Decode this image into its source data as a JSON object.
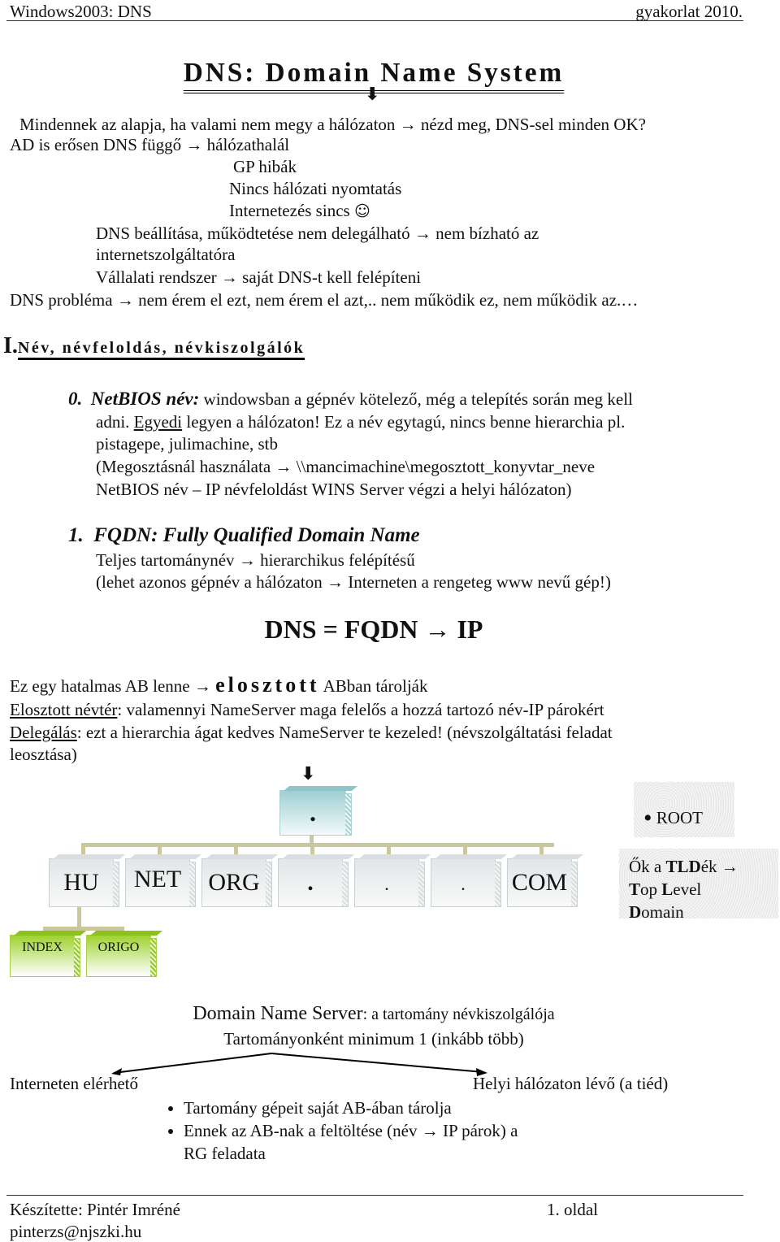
{
  "header": {
    "left": "Windows2003: DNS",
    "right": "gyakorlat 2010."
  },
  "title": "DNS: Domain Name System",
  "icons": {
    "arrow_right": "→",
    "arrow_down": "⬇",
    "smiley": "☺"
  },
  "intro": {
    "line1": "Mindennek az alapja, ha valami nem megy a hálózaton",
    "line1b": "nézd meg, DNS-sel minden OK?",
    "line2": "AD is erősen DNS függő",
    "line2b": "hálózathalál",
    "line3": "GP hibák",
    "line4": "Nincs hálózati nyomtatás",
    "line5": "Internetezés sincs",
    "line6": "DNS beállítása, működtetése nem delegálható",
    "line6b": "nem bízható az",
    "line7": "internetszolgáltatóra",
    "line8": "Vállalati rendszer",
    "line8b": "saját DNS-t kell felépíteni",
    "line9": "DNS probléma",
    "line9b": "nem érem el ezt, nem érem el azt,.. nem működik ez, nem működik az.…"
  },
  "section1": {
    "number": "I.",
    "title": "Név, névfeloldás, névkiszolgálók"
  },
  "netbios": {
    "number": "0.",
    "heading": "NetBIOS név:",
    "text1": "windowsban a gépnév kötelező, még a telepítés során meg kell",
    "text2a": "adni.",
    "text2u": "Egyedi",
    "text2b": "legyen a hálózaton! Ez a név egytagú, nincs benne hierarchia pl.",
    "text3": "pistagepe, julimachine, stb",
    "text4a": "(Megosztásnál használata",
    "text4b": "\\\\mancimachine\\megosztott_konyvtar_neve",
    "text5": "NetBIOS név – IP névfeloldást WINS Server végzi a helyi hálózaton)"
  },
  "fqdn": {
    "number": "1.",
    "heading": "FQDN: Fully Qualified Domain Name",
    "text1a": "Teljes tartománynév",
    "text1b": "hierarchikus felépítésű",
    "text2a": "(lehet azonos gépnév a hálózaton",
    "text2b": "Interneten a rengeteg www nevű gép!)"
  },
  "formula": {
    "left": "DNS = FQDN",
    "right": "IP"
  },
  "distributed": {
    "line1a": "Ez egy hatalmas AB lenne",
    "line1b": "elosztott",
    "line1c": "ABban tárolják",
    "line2u": "Elosztott névtér",
    "line2": ": valamennyi NameServer maga felelős a hozzá tartozó név-IP párokért",
    "line3u": "Delegálás",
    "line3": ": ezt a hierarchia ágat kedves NameServer te kezeled! (névszolgáltatási feladat",
    "line4": "leosztása)"
  },
  "diagram": {
    "root_label": ".",
    "root_note": "ROOT",
    "root_note_bullet": "•",
    "tlds": [
      "HU",
      "NET",
      "ORG",
      ".",
      ".",
      ".",
      "COM"
    ],
    "subdomains": [
      "INDEX",
      "ORIGO"
    ],
    "tld_note": {
      "a": "Ők a ",
      "b": "TLD",
      "c": "ék ",
      "d": "T",
      "e": "op ",
      "f": "L",
      "g": "evel",
      "h": "D",
      "i": "omain"
    }
  },
  "dns_server": {
    "title": "Domain Name Server",
    "title_suffix": ": a tartomány névkiszolgálója",
    "min": "Tartományonként minimum 1 (inkább több)",
    "left": "Interneten elérhető",
    "right": "Helyi hálózaton lévő (a tiéd)",
    "bullets": [
      "Tartomány gépeit saját AB-ában tárolja",
      "Ennek az AB-nak a feltöltése (név",
      "IP párok) a",
      "RG feladata"
    ]
  },
  "footer": {
    "author": "Készítette: Pintér Imréné",
    "email": "pinterzs@njszki.hu",
    "page": "1. oldal"
  }
}
